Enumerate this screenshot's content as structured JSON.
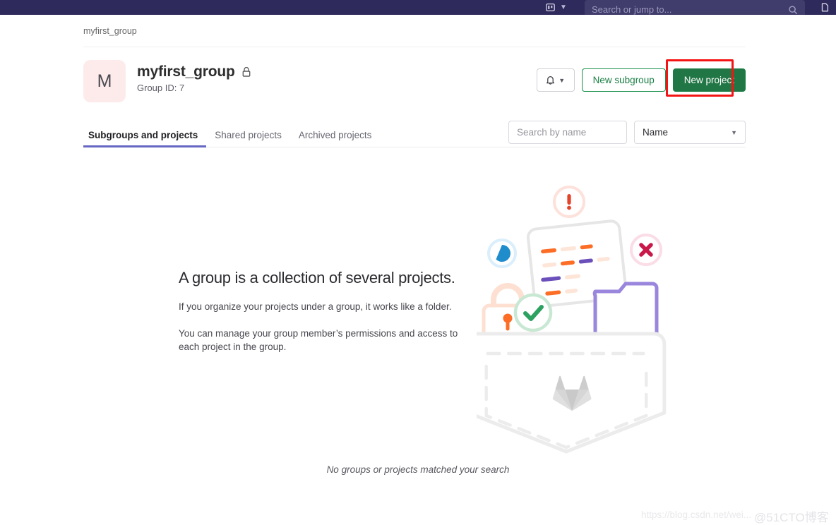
{
  "topbar": {
    "search_placeholder": "Search or jump to...",
    "icons": {
      "board": "board-icon",
      "chevron": "chevron-down-icon",
      "search": "search-icon",
      "right": "issues-icon"
    },
    "bg_color": "#2e2a5b"
  },
  "breadcrumb": {
    "label": "myfirst_group"
  },
  "group": {
    "avatar_letter": "M",
    "avatar_color": "#fdebeb",
    "name": "myfirst_group",
    "visibility_icon": "lock-icon",
    "group_id_label": "Group ID: 7"
  },
  "actions": {
    "bell_icon": "bell-icon",
    "bell_chevron": "chevron-down-icon",
    "new_subgroup_label": "New subgroup",
    "new_project_label": "New project",
    "new_project_color": "#217645",
    "annotation_color": "#f41414"
  },
  "tabs": [
    {
      "label": "Subgroups and projects",
      "active": true
    },
    {
      "label": "Shared projects",
      "active": false
    },
    {
      "label": "Archived projects",
      "active": false
    }
  ],
  "tab_accent_color": "#6666c4",
  "filters": {
    "search_placeholder": "Search by name",
    "search_value": "",
    "sort_label": "Name",
    "sort_chevron": "chevron-down-icon"
  },
  "empty_state": {
    "title": "A group is a collection of several projects.",
    "paragraph_1": "If you organize your projects under a group, it works like a folder.",
    "paragraph_2": "You can manage your group member’s permissions and access to each project in the group.",
    "illustration_name": "empty-group-pocket-illustration",
    "footer_message": "No groups or projects matched your search"
  },
  "watermarks": {
    "csdn": "https://blog.csdn.net/wei...",
    "cto": "@51CTO博客"
  }
}
